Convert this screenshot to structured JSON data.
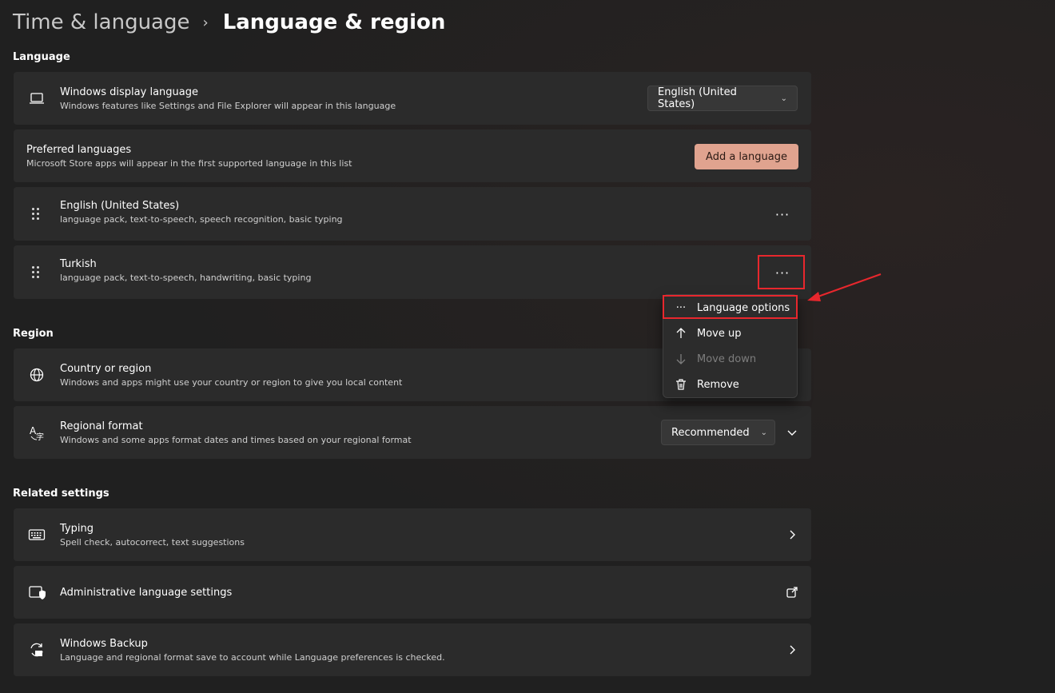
{
  "breadcrumb": {
    "parent": "Time & language",
    "current": "Language & region"
  },
  "sections": {
    "language": "Language",
    "region": "Region",
    "related": "Related settings"
  },
  "display_language": {
    "title": "Windows display language",
    "subtitle": "Windows features like Settings and File Explorer will appear in this language",
    "value": "English (United States)",
    "icon": "laptop-icon"
  },
  "preferred": {
    "title": "Preferred languages",
    "subtitle": "Microsoft Store apps will appear in the first supported language in this list",
    "button": "Add a language"
  },
  "languages": [
    {
      "name": "English (United States)",
      "features": "language pack, text-to-speech, speech recognition, basic typing",
      "more": "···"
    },
    {
      "name": "Turkish",
      "features": "language pack, text-to-speech, handwriting, basic typing",
      "more": "···"
    }
  ],
  "context_menu": {
    "items": [
      {
        "label": "Language options",
        "icon": "more-icon",
        "enabled": true
      },
      {
        "label": "Move up",
        "icon": "arrow-up-icon",
        "enabled": true
      },
      {
        "label": "Move down",
        "icon": "arrow-down-icon",
        "enabled": false
      },
      {
        "label": "Remove",
        "icon": "trash-icon",
        "enabled": true
      }
    ]
  },
  "country": {
    "title": "Country or region",
    "subtitle": "Windows and apps might use your country or region to give you local content",
    "icon": "globe-icon"
  },
  "regional_format": {
    "title": "Regional format",
    "subtitle": "Windows and some apps format dates and times based on your regional format",
    "value": "Recommended",
    "icon": "regional-format-icon"
  },
  "related": [
    {
      "title": "Typing",
      "subtitle": "Spell check, autocorrect, text suggestions",
      "icon": "keyboard-icon",
      "action": "chevron-right-icon"
    },
    {
      "title": "Administrative language settings",
      "subtitle": "",
      "icon": "admin-shield-icon",
      "action": "external-link-icon"
    },
    {
      "title": "Windows Backup",
      "subtitle": "Language and regional format save to account while Language preferences is checked.",
      "icon": "backup-icon",
      "action": "chevron-right-icon"
    }
  ],
  "colors": {
    "accent": "#e0a38f",
    "highlight": "#e8272d",
    "card": "#2b2b2b",
    "background": "#202020"
  }
}
